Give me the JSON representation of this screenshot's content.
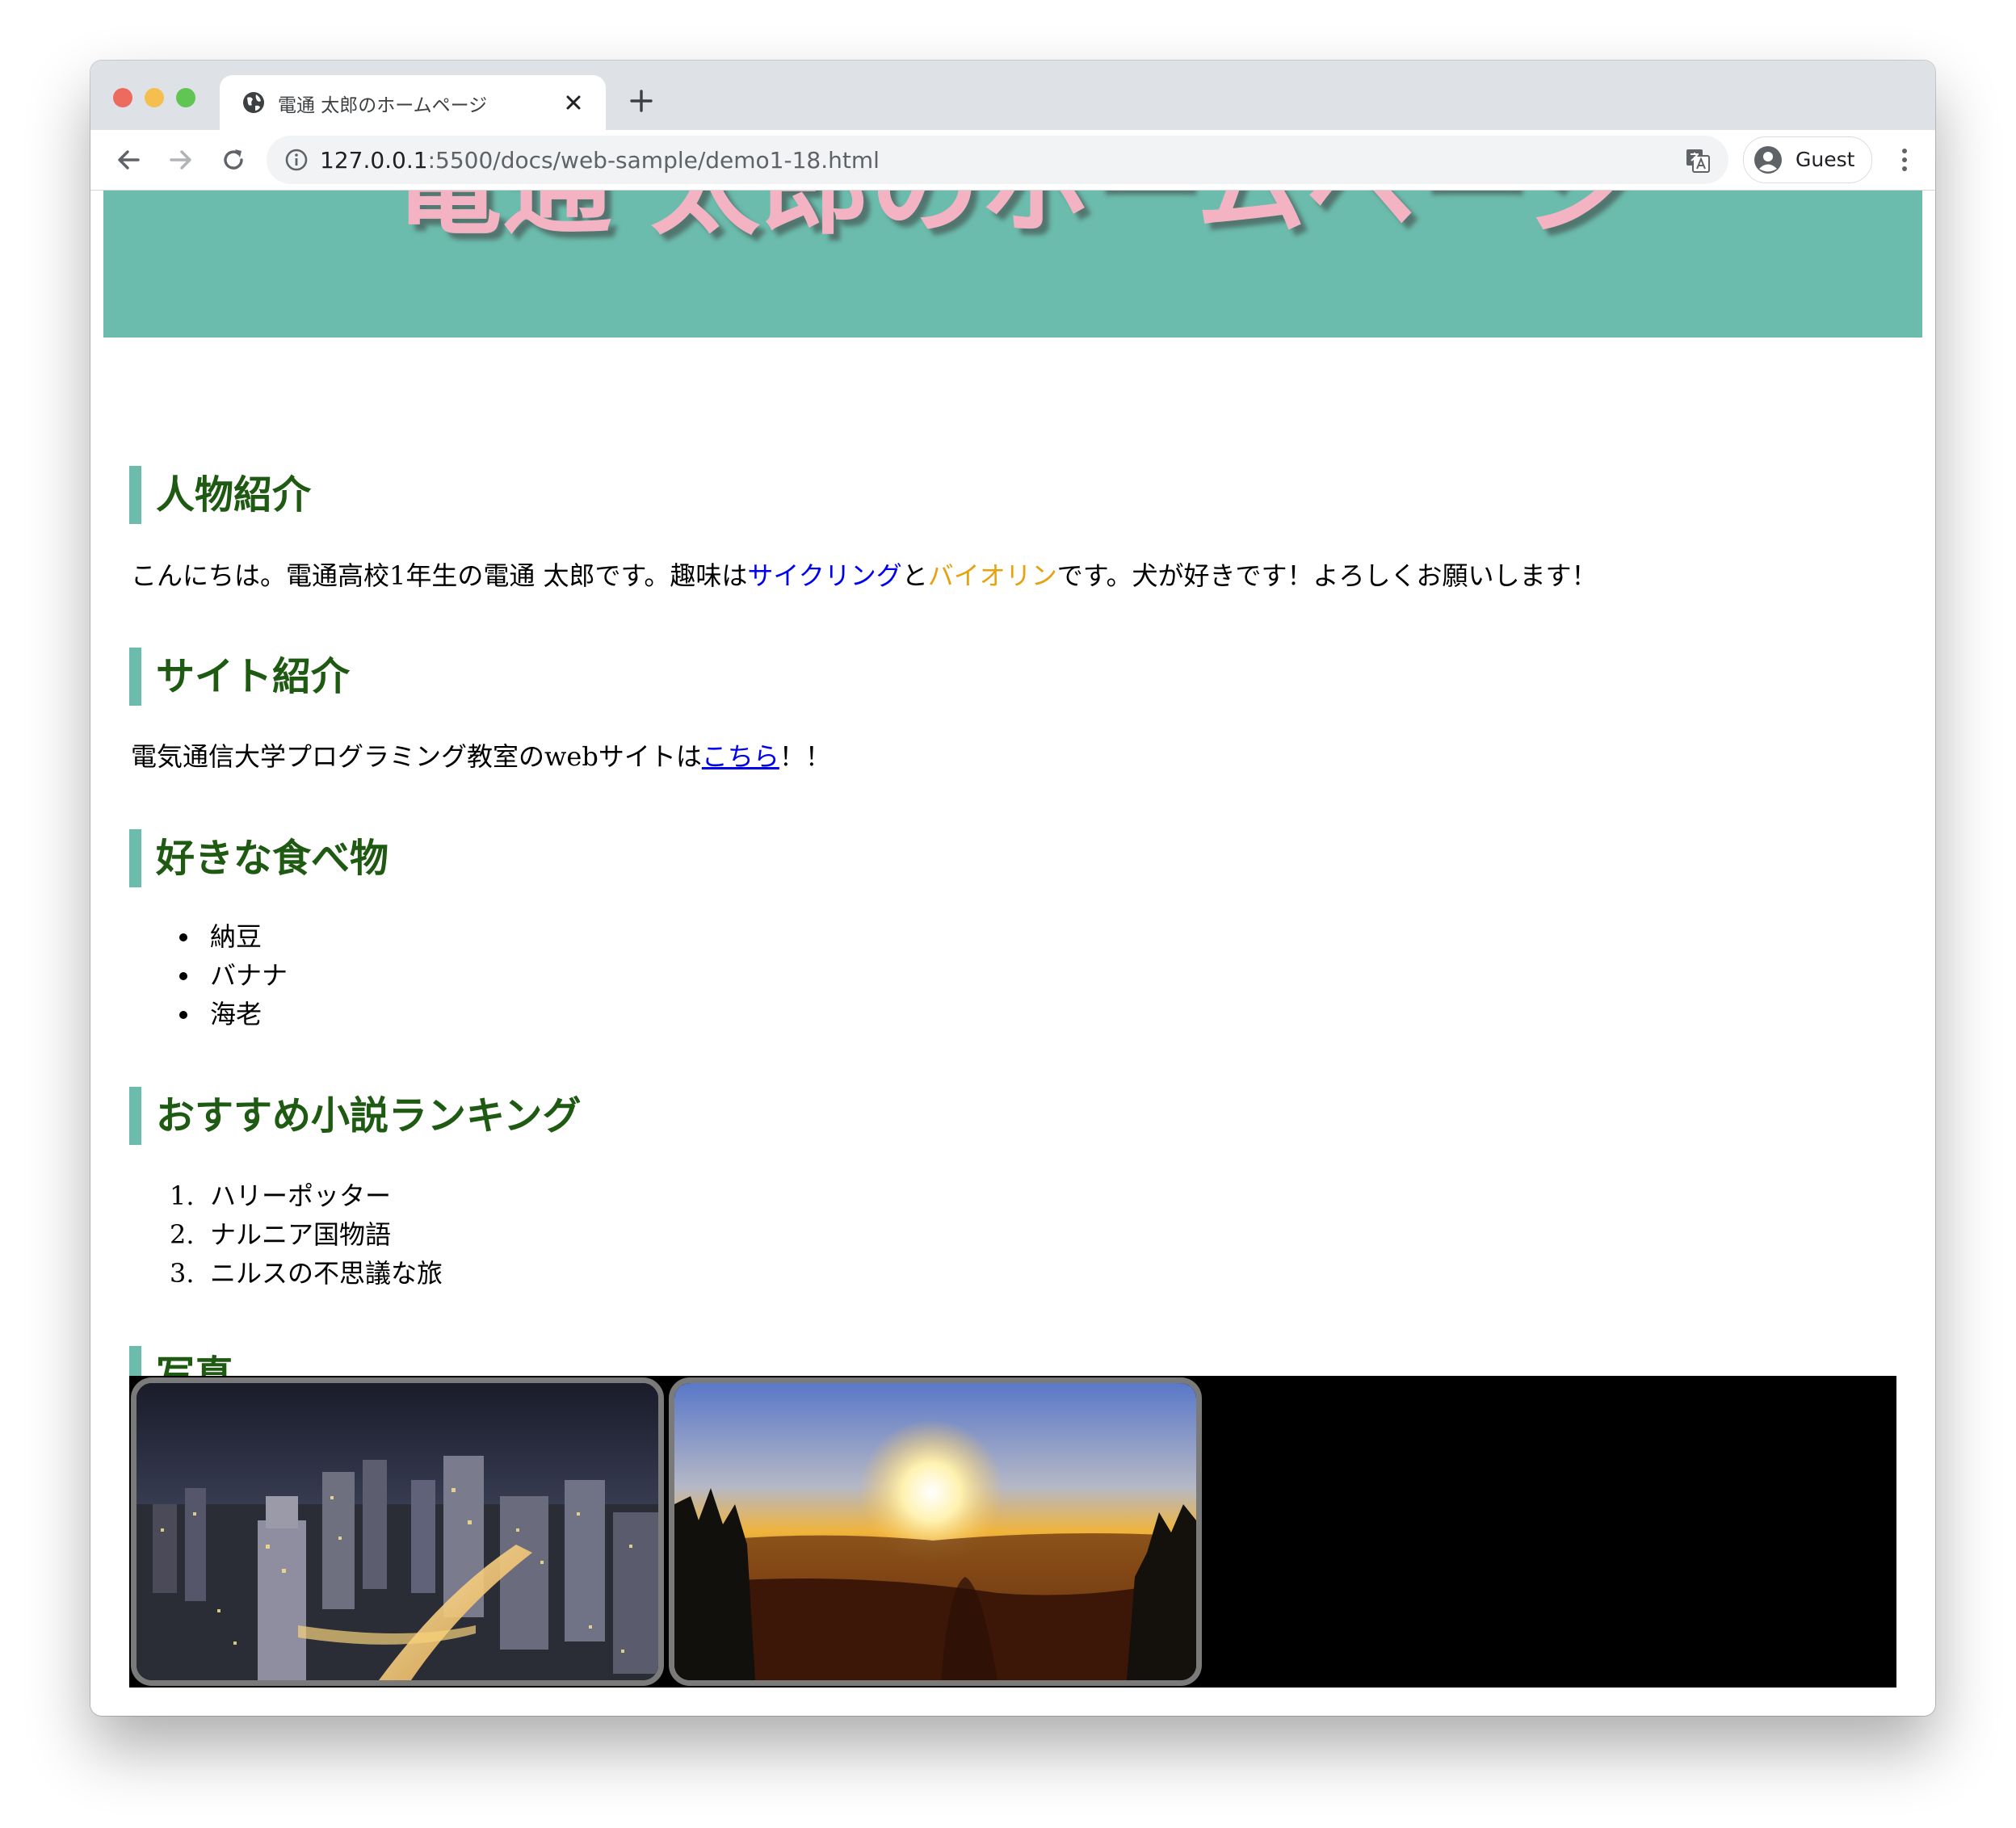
{
  "browser": {
    "tab_title": "電通 太郎のホームページ",
    "url_host": "127.0.0.1",
    "url_rest": ":5500/docs/web-sample/demo1-18.html",
    "profile_label": "Guest"
  },
  "page": {
    "banner_title": "電通 太郎のホームページ",
    "sections": {
      "intro": {
        "heading": "人物紹介",
        "text_before": "こんにちは。電通高校1年生の電通 太郎です。趣味は",
        "hobby1": "サイクリング",
        "joiner": "と",
        "hobby2": "バイオリン",
        "text_after": "です。犬が好きです！よろしくお願いします！"
      },
      "site": {
        "heading": "サイト紹介",
        "text_before": "電気通信大学プログラミング教室のwebサイトは",
        "link": "こちら",
        "text_after": "！！"
      },
      "food": {
        "heading": "好きな食べ物",
        "items": [
          "納豆",
          "バナナ",
          "海老"
        ]
      },
      "novels": {
        "heading": "おすすめ小説ランキング",
        "numbers": [
          "1.",
          "2.",
          "3."
        ],
        "items": [
          "ハリーポッター",
          "ナルニア国物語",
          "ニルスの不思議な旅"
        ]
      },
      "photos": {
        "heading": "写真"
      }
    }
  },
  "colors": {
    "banner_bg": "#6cbcad",
    "banner_text": "#f4b3c3",
    "heading_text": "#1e5a12",
    "heading_bar": "#6cbcad",
    "link_blue": "#0000ee",
    "link_orange": "#e8a10f"
  },
  "icons": [
    "globe-icon",
    "close-icon",
    "plus-icon",
    "back-arrow-icon",
    "forward-arrow-icon",
    "reload-icon",
    "info-icon",
    "translate-icon",
    "guest-avatar-icon",
    "more-vert-icon"
  ]
}
